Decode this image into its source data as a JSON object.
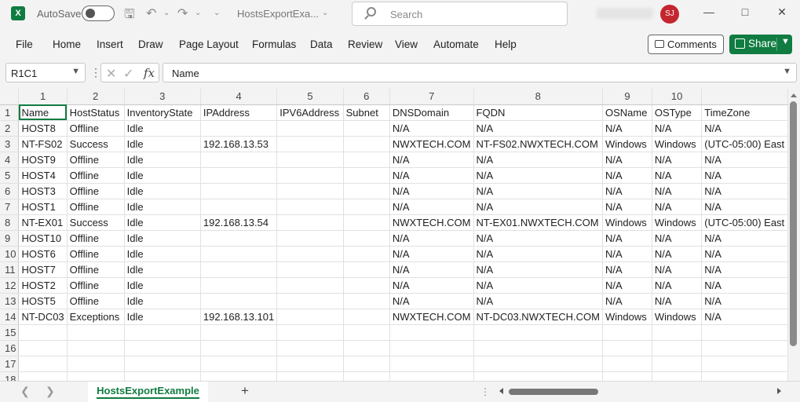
{
  "titlebar": {
    "app_logo": "X",
    "autosave_label": "AutoSave",
    "doc_title": "HostsExportExa...",
    "search_placeholder": "Search",
    "user_initials": "SJ",
    "icons": [
      "save-icon",
      "undo-icon",
      "redo-icon",
      "minimize-icon",
      "restore-icon",
      "close-icon"
    ]
  },
  "menu": {
    "items": [
      "File",
      "Home",
      "Insert",
      "Draw",
      "Page Layout",
      "Formulas",
      "Data",
      "Review",
      "View",
      "Automate",
      "Help"
    ],
    "comments_label": "Comments",
    "share_label": "Share"
  },
  "formula_bar": {
    "name_box": "R1C1",
    "formula": "Name"
  },
  "grid": {
    "col_numbers": [
      "1",
      "2",
      "3",
      "4",
      "5",
      "6",
      "7",
      "8",
      "9",
      "10"
    ],
    "rows": [
      {
        "n": "1",
        "cells": [
          "Name",
          "HostStatus",
          "InventoryState",
          "IPAddress",
          "IPV6Address",
          "Subnet",
          "DNSDomain",
          "FQDN",
          "OSName",
          "OSType",
          "TimeZone"
        ]
      },
      {
        "n": "2",
        "cells": [
          "HOST8",
          "Offline",
          "Idle",
          "",
          "",
          "",
          "N/A",
          "N/A",
          "N/A",
          "N/A",
          "N/A"
        ]
      },
      {
        "n": "3",
        "cells": [
          "NT-FS02",
          "Success",
          "Idle",
          "192.168.13.53",
          "",
          "",
          "NWXTECH.COM",
          "NT-FS02.NWXTECH.COM",
          "Windows",
          "Windows",
          "(UTC-05:00) East"
        ]
      },
      {
        "n": "4",
        "cells": [
          "HOST9",
          "Offline",
          "Idle",
          "",
          "",
          "",
          "N/A",
          "N/A",
          "N/A",
          "N/A",
          "N/A"
        ]
      },
      {
        "n": "5",
        "cells": [
          "HOST4",
          "Offline",
          "Idle",
          "",
          "",
          "",
          "N/A",
          "N/A",
          "N/A",
          "N/A",
          "N/A"
        ]
      },
      {
        "n": "6",
        "cells": [
          "HOST3",
          "Offline",
          "Idle",
          "",
          "",
          "",
          "N/A",
          "N/A",
          "N/A",
          "N/A",
          "N/A"
        ]
      },
      {
        "n": "7",
        "cells": [
          "HOST1",
          "Offline",
          "Idle",
          "",
          "",
          "",
          "N/A",
          "N/A",
          "N/A",
          "N/A",
          "N/A"
        ]
      },
      {
        "n": "8",
        "cells": [
          "NT-EX01",
          "Success",
          "Idle",
          "192.168.13.54",
          "",
          "",
          "NWXTECH.COM",
          "NT-EX01.NWXTECH.COM",
          "Windows",
          "Windows",
          "(UTC-05:00) East"
        ]
      },
      {
        "n": "9",
        "cells": [
          "HOST10",
          "Offline",
          "Idle",
          "",
          "",
          "",
          "N/A",
          "N/A",
          "N/A",
          "N/A",
          "N/A"
        ]
      },
      {
        "n": "10",
        "cells": [
          "HOST6",
          "Offline",
          "Idle",
          "",
          "",
          "",
          "N/A",
          "N/A",
          "N/A",
          "N/A",
          "N/A"
        ]
      },
      {
        "n": "11",
        "cells": [
          "HOST7",
          "Offline",
          "Idle",
          "",
          "",
          "",
          "N/A",
          "N/A",
          "N/A",
          "N/A",
          "N/A"
        ]
      },
      {
        "n": "12",
        "cells": [
          "HOST2",
          "Offline",
          "Idle",
          "",
          "",
          "",
          "N/A",
          "N/A",
          "N/A",
          "N/A",
          "N/A"
        ]
      },
      {
        "n": "13",
        "cells": [
          "HOST5",
          "Offline",
          "Idle",
          "",
          "",
          "",
          "N/A",
          "N/A",
          "N/A",
          "N/A",
          "N/A"
        ]
      },
      {
        "n": "14",
        "cells": [
          "NT-DC03",
          "Exceptions",
          "Idle",
          "192.168.13.101",
          "",
          "",
          "NWXTECH.COM",
          "NT-DC03.NWXTECH.COM",
          "Windows",
          "Windows",
          "N/A"
        ]
      },
      {
        "n": "15",
        "cells": [
          "",
          "",
          "",
          "",
          "",
          "",
          "",
          "",
          "",
          "",
          ""
        ]
      },
      {
        "n": "16",
        "cells": [
          "",
          "",
          "",
          "",
          "",
          "",
          "",
          "",
          "",
          "",
          ""
        ]
      },
      {
        "n": "17",
        "cells": [
          "",
          "",
          "",
          "",
          "",
          "",
          "",
          "",
          "",
          "",
          ""
        ]
      },
      {
        "n": "18",
        "cells": [
          "",
          "",
          "",
          "",
          "",
          "",
          "",
          "",
          "",
          "",
          ""
        ]
      }
    ]
  },
  "sheets": {
    "active_tab": "HostsExportExample",
    "add_label": "+"
  },
  "colors": {
    "accent": "#107c41",
    "avatar": "#c4262e"
  }
}
